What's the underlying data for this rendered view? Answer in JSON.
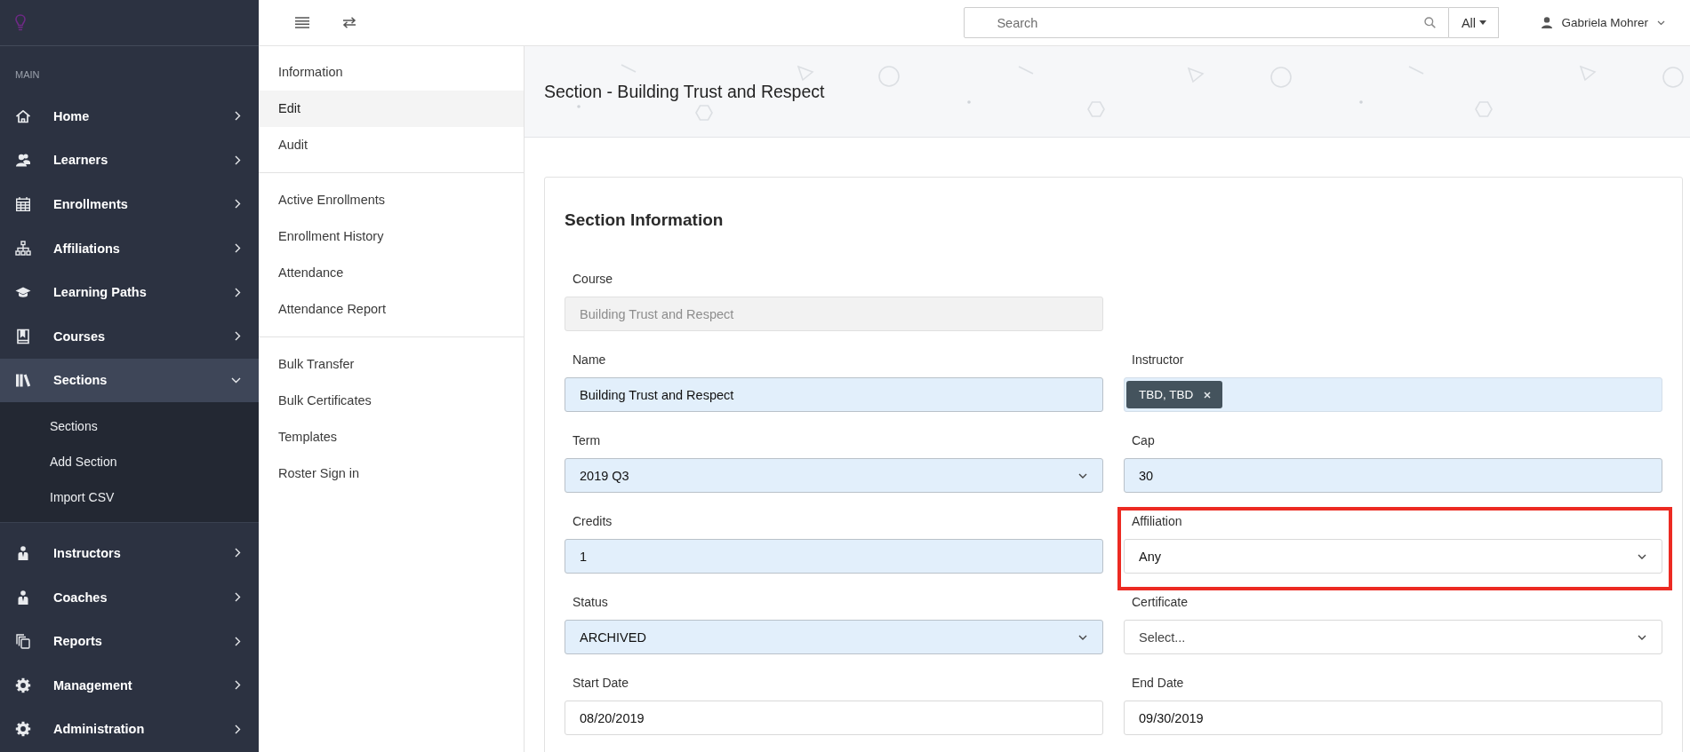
{
  "sidebar": {
    "section_label": "MAIN",
    "items": [
      {
        "label": "Home",
        "selected": false,
        "expanded": false
      },
      {
        "label": "Learners",
        "selected": false,
        "expanded": false
      },
      {
        "label": "Enrollments",
        "selected": false,
        "expanded": false
      },
      {
        "label": "Affiliations",
        "selected": false,
        "expanded": false
      },
      {
        "label": "Learning Paths",
        "selected": false,
        "expanded": false
      },
      {
        "label": "Courses",
        "selected": false,
        "expanded": false
      },
      {
        "label": "Sections",
        "selected": true,
        "expanded": true,
        "children": [
          {
            "label": "Sections"
          },
          {
            "label": "Add Section"
          },
          {
            "label": "Import CSV"
          }
        ]
      },
      {
        "label": "Instructors",
        "selected": false,
        "expanded": false
      },
      {
        "label": "Coaches",
        "selected": false,
        "expanded": false
      },
      {
        "label": "Reports",
        "selected": false,
        "expanded": false
      },
      {
        "label": "Management",
        "selected": false,
        "expanded": false
      },
      {
        "label": "Administration",
        "selected": false,
        "expanded": false
      }
    ]
  },
  "topbar": {
    "search": {
      "placeholder": "Search",
      "scope": "All"
    },
    "user": {
      "name": "Gabriela Mohrer"
    }
  },
  "subnav": {
    "groups": [
      [
        {
          "label": "Information",
          "selected": false
        },
        {
          "label": "Edit",
          "selected": true
        },
        {
          "label": "Audit",
          "selected": false
        }
      ],
      [
        {
          "label": "Active Enrollments",
          "selected": false
        },
        {
          "label": "Enrollment History",
          "selected": false
        },
        {
          "label": "Attendance",
          "selected": false
        },
        {
          "label": "Attendance Report",
          "selected": false
        }
      ],
      [
        {
          "label": "Bulk Transfer",
          "selected": false
        },
        {
          "label": "Bulk Certificates",
          "selected": false
        },
        {
          "label": "Templates",
          "selected": false
        },
        {
          "label": "Roster Sign in",
          "selected": false
        }
      ]
    ]
  },
  "header": {
    "title": "Section - Building Trust and Respect"
  },
  "form": {
    "title": "Section Information",
    "rows": [
      [
        {
          "label": "Course",
          "kind": "text",
          "value": "Building Trust and Respect",
          "highlighted": false,
          "disabled": true,
          "framed": false
        }
      ],
      [
        {
          "label": "Name",
          "kind": "text",
          "value": "Building Trust and Respect",
          "highlighted": true,
          "disabled": false,
          "framed": false
        },
        {
          "label": "Instructor",
          "kind": "tags",
          "tags": [
            {
              "label": "TBD, TBD"
            }
          ],
          "highlighted": true,
          "disabled": false,
          "framed": false
        }
      ],
      [
        {
          "label": "Term",
          "kind": "select",
          "value": "2019 Q3",
          "highlighted": true,
          "disabled": false,
          "framed": false
        },
        {
          "label": "Cap",
          "kind": "text",
          "value": "30",
          "highlighted": true,
          "disabled": false,
          "framed": false
        }
      ],
      [
        {
          "label": "Credits",
          "kind": "text",
          "value": "1",
          "highlighted": true,
          "disabled": false,
          "framed": false
        },
        {
          "label": "Affiliation",
          "kind": "select",
          "value": "Any",
          "highlighted": false,
          "disabled": false,
          "framed": true
        }
      ],
      [
        {
          "label": "Status",
          "kind": "select",
          "value": "ARCHIVED",
          "highlighted": true,
          "disabled": false,
          "framed": false
        },
        {
          "label": "Certificate",
          "kind": "select",
          "placeholder": "Select...",
          "highlighted": false,
          "disabled": false,
          "framed": false
        }
      ],
      [
        {
          "label": "Start Date",
          "kind": "text",
          "value": "08/20/2019",
          "highlighted": false,
          "disabled": false,
          "framed": false
        },
        {
          "label": "End Date",
          "kind": "text",
          "value": "09/30/2019",
          "highlighted": false,
          "disabled": false,
          "framed": false
        }
      ]
    ]
  }
}
